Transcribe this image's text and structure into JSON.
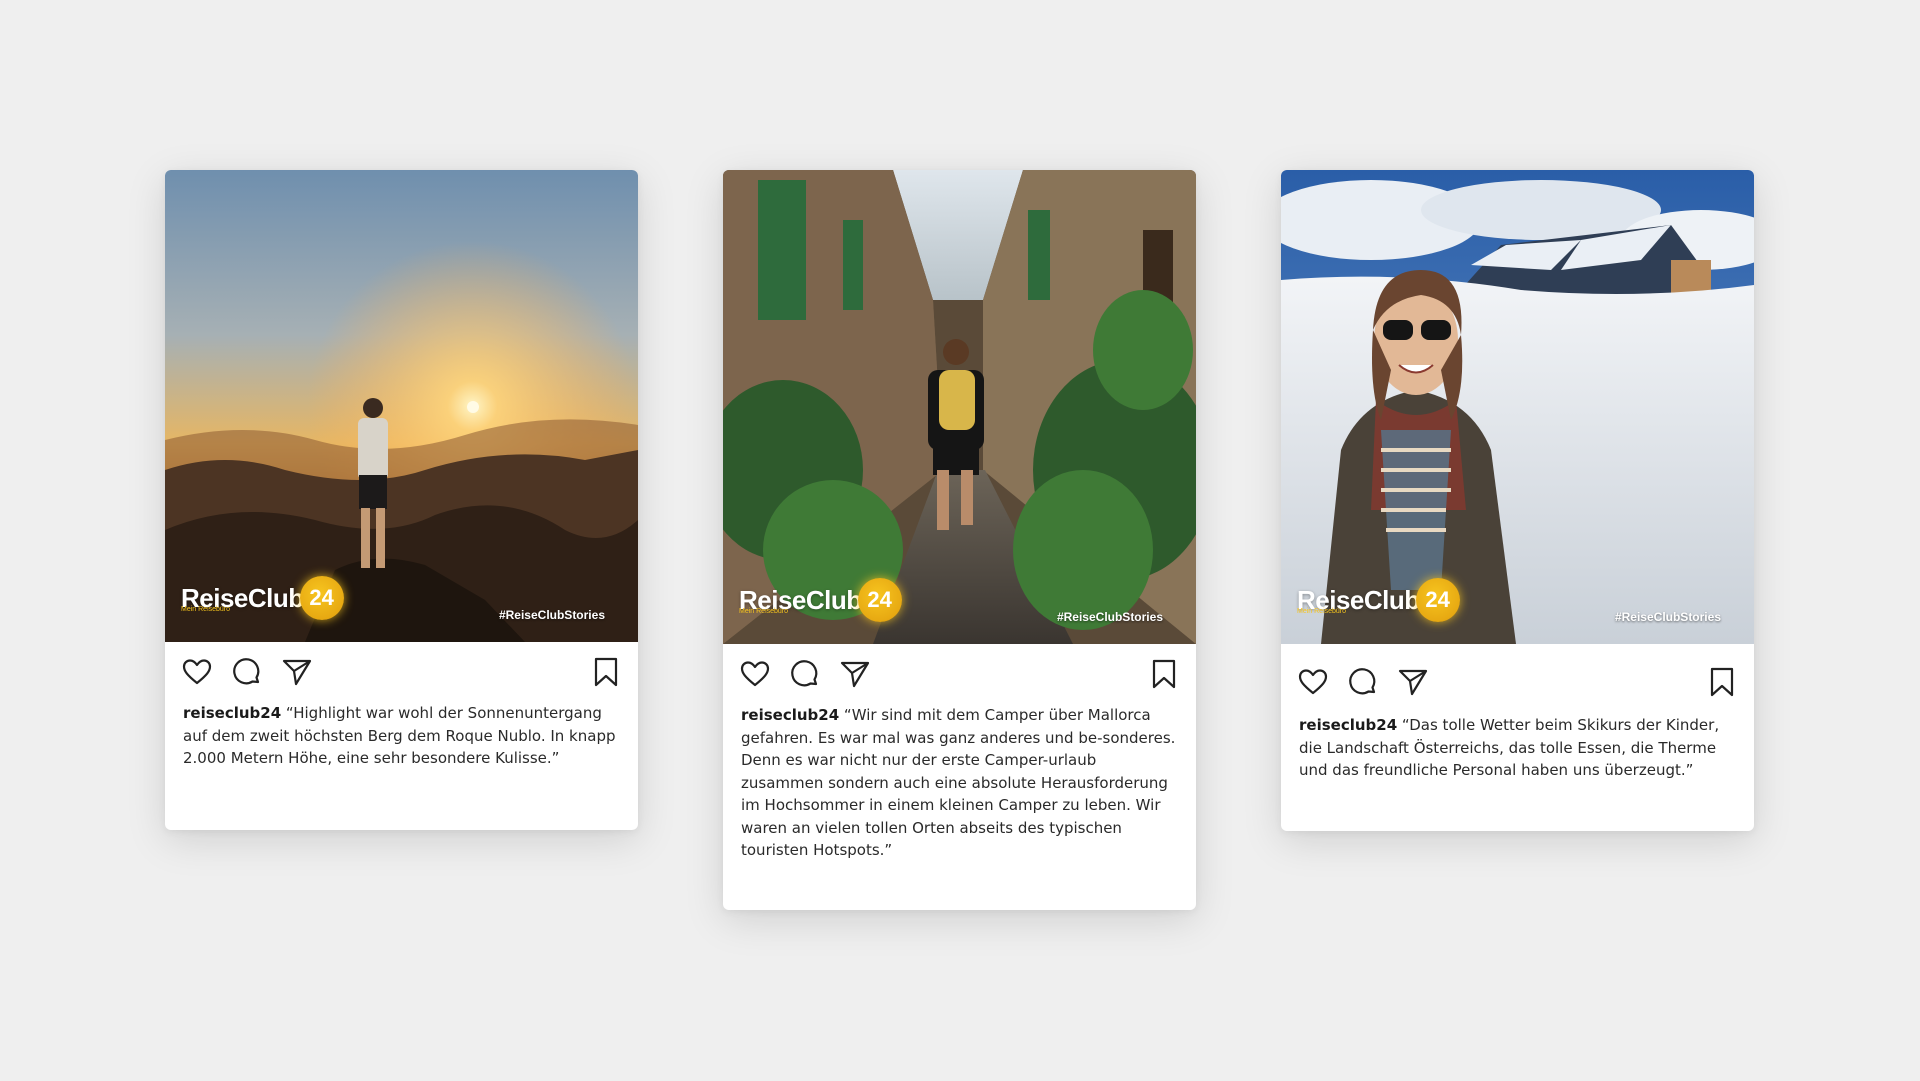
{
  "posts": [
    {
      "brand": "ReiseClub",
      "brand_badge": "24",
      "brand_sub": "Mein Reisebüro",
      "hashtag": "#ReiseClubStories",
      "username": "reiseclub24",
      "caption": "“Highlight war wohl der Sonnenuntergang auf dem zweit höchsten Berg dem Roque Nublo. In knapp 2.000 Metern Höhe, eine sehr besondere Kulisse.”"
    },
    {
      "brand": "ReiseClub",
      "brand_badge": "24",
      "brand_sub": "Mein Reisebüro",
      "hashtag": "#ReiseClubStories",
      "username": "reiseclub24",
      "caption": "“Wir sind mit dem Camper über Mallorca gefahren. Es war mal was ganz anderes und be-sonderes. Denn es war nicht nur der erste Camper-urlaub zusammen sondern auch eine absolute Herausforderung im Hochsommer in einem kleinen Camper zu leben. Wir waren an vielen tollen Orten abseits des typischen touristen Hotspots.”"
    },
    {
      "brand": "ReiseClub",
      "brand_badge": "24",
      "brand_sub": "Mein Reisebüro",
      "hashtag": "#ReiseClubStories",
      "username": "reiseclub24",
      "caption": "“Das tolle Wetter beim Skikurs der Kinder, die Landschaft Österreichs, das tolle Essen, die Therme und das freundliche Personal haben uns überzeugt.”"
    }
  ],
  "icons": [
    "heart-icon",
    "comment-icon",
    "share-icon",
    "bookmark-icon"
  ],
  "colors": {
    "background": "#efefef",
    "card": "#ffffff",
    "brand_yellow": "#f7c51f"
  }
}
